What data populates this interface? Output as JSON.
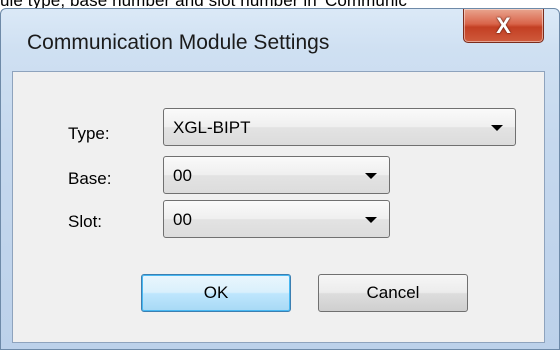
{
  "background": {
    "caption_text": "ule type, base number and slot number in 'Communic"
  },
  "window": {
    "title": "Communication Module Settings",
    "close_glyph": "X"
  },
  "form": {
    "type_label": "Type:",
    "type_value": "XGL-BIPT",
    "base_label": "Base:",
    "base_value": "00",
    "slot_label": "Slot:",
    "slot_value": "00"
  },
  "buttons": {
    "ok_label": "OK",
    "cancel_label": "Cancel"
  },
  "icons": {
    "close": "close-icon",
    "dropdown": "chevron-down-icon"
  }
}
